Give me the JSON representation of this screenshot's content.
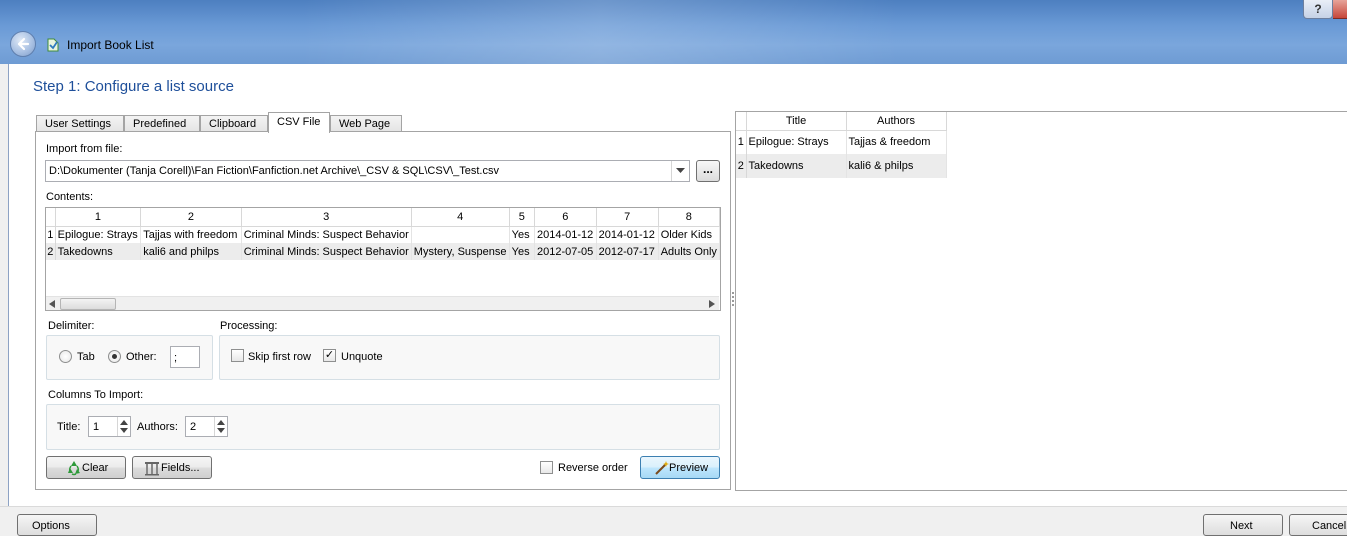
{
  "window": {
    "title": "Import Book List",
    "help_label": "?"
  },
  "step_title": "Step 1: Configure a list source",
  "tabs": [
    {
      "label": "User Settings"
    },
    {
      "label": "Predefined"
    },
    {
      "label": "Clipboard"
    },
    {
      "label": "CSV File"
    },
    {
      "label": "Web Page"
    }
  ],
  "csv": {
    "import_label": "Import from file:",
    "file_path": "D:\\Dokumenter (Tanja Corell)\\Fan Fiction\\Fanfiction.net Archive\\_CSV & SQL\\CSV\\_Test.csv",
    "browse_label": "...",
    "contents_label": "Contents:",
    "columns": [
      "1",
      "2",
      "3",
      "4",
      "5",
      "6",
      "7",
      "8"
    ],
    "rows": [
      {
        "n": "1",
        "cells": [
          "Epilogue: Strays",
          "Tajjas with freedom",
          "Criminal Minds: Suspect Behavior",
          "",
          "Yes",
          "2014-01-12",
          "2014-01-12",
          "Older Kids"
        ]
      },
      {
        "n": "2",
        "cells": [
          "Takedowns",
          "kali6 and philps",
          "Criminal Minds: Suspect Behavior",
          "Mystery, Suspense",
          "Yes",
          "2012-07-05",
          "2012-07-17",
          "Adults Only"
        ]
      }
    ],
    "delimiter_label": "Delimiter:",
    "tab_label": "Tab",
    "other_label": "Other:",
    "other_value": ";",
    "processing_label": "Processing:",
    "skip_first_row_label": "Skip first row",
    "skip_first_row_checked": false,
    "unquote_label": "Unquote",
    "unquote_checked": true,
    "columns_to_import_label": "Columns To Import:",
    "title_label": "Title:",
    "title_value": "1",
    "authors_label": "Authors:",
    "authors_value": "2",
    "clear_label": "Clear",
    "fields_label": "Fields...",
    "reverse_order_label": "Reverse order",
    "preview_label": "Preview"
  },
  "preview": {
    "columns": [
      "Title",
      "Authors"
    ],
    "rows": [
      {
        "n": "1",
        "title": "Epilogue: Strays",
        "authors": "Tajjas & freedom"
      },
      {
        "n": "2",
        "title": "Takedowns",
        "authors": "kali6 & philps"
      }
    ]
  },
  "footer": {
    "options_label": "Options",
    "next_label": "Next",
    "cancel_label": "Cancel"
  },
  "colors": {
    "titlebar": "#6a9ad6",
    "step_title": "#1e4f9a",
    "alt_row": "#ececec"
  }
}
